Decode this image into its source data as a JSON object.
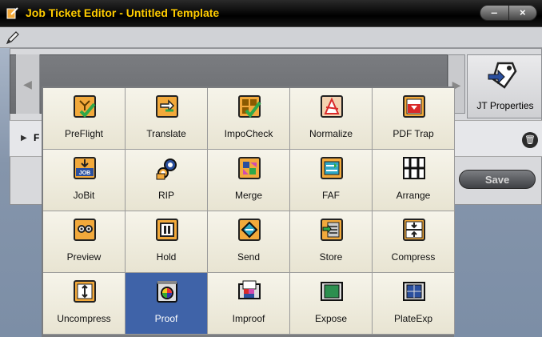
{
  "window": {
    "title": "Job Ticket Editor - Untitled Template",
    "minimize_label": "‒",
    "close_label": "×"
  },
  "editor": {
    "left_arrow": "◀",
    "right_arrow": "▶",
    "jt_properties_label": "JT Properties",
    "row_label": "F",
    "expand_arrow": "▶",
    "save_label": "Save"
  },
  "popup": {
    "selected": "Proof",
    "items": [
      {
        "label": "PreFlight",
        "icon": "preflight-icon"
      },
      {
        "label": "Translate",
        "icon": "translate-icon"
      },
      {
        "label": "ImpoCheck",
        "icon": "impocheck-icon"
      },
      {
        "label": "Normalize",
        "icon": "normalize-icon"
      },
      {
        "label": "PDF Trap",
        "icon": "pdf-trap-icon"
      },
      {
        "label": "JoBit",
        "icon": "jobit-icon",
        "icon_text": "JOB"
      },
      {
        "label": "RIP",
        "icon": "rip-icon"
      },
      {
        "label": "Merge",
        "icon": "merge-icon"
      },
      {
        "label": "FAF",
        "icon": "faf-icon"
      },
      {
        "label": "Arrange",
        "icon": "arrange-icon"
      },
      {
        "label": "Preview",
        "icon": "preview-icon"
      },
      {
        "label": "Hold",
        "icon": "hold-icon"
      },
      {
        "label": "Send",
        "icon": "send-icon"
      },
      {
        "label": "Store",
        "icon": "store-icon"
      },
      {
        "label": "Compress",
        "icon": "compress-icon"
      },
      {
        "label": "Uncompress",
        "icon": "uncompress-icon"
      },
      {
        "label": "Proof",
        "icon": "proof-icon"
      },
      {
        "label": "Improof",
        "icon": "improof-icon"
      },
      {
        "label": "Expose",
        "icon": "expose-icon"
      },
      {
        "label": "PlateExp",
        "icon": "plateexp-icon"
      }
    ]
  },
  "colors": {
    "title_text": "#ffcc00",
    "selection": "#3f63a8",
    "icon_orange": "#f2a93b",
    "icon_green": "#2fa84a",
    "icon_red": "#d92a2a",
    "icon_blue": "#2a4f9e"
  }
}
